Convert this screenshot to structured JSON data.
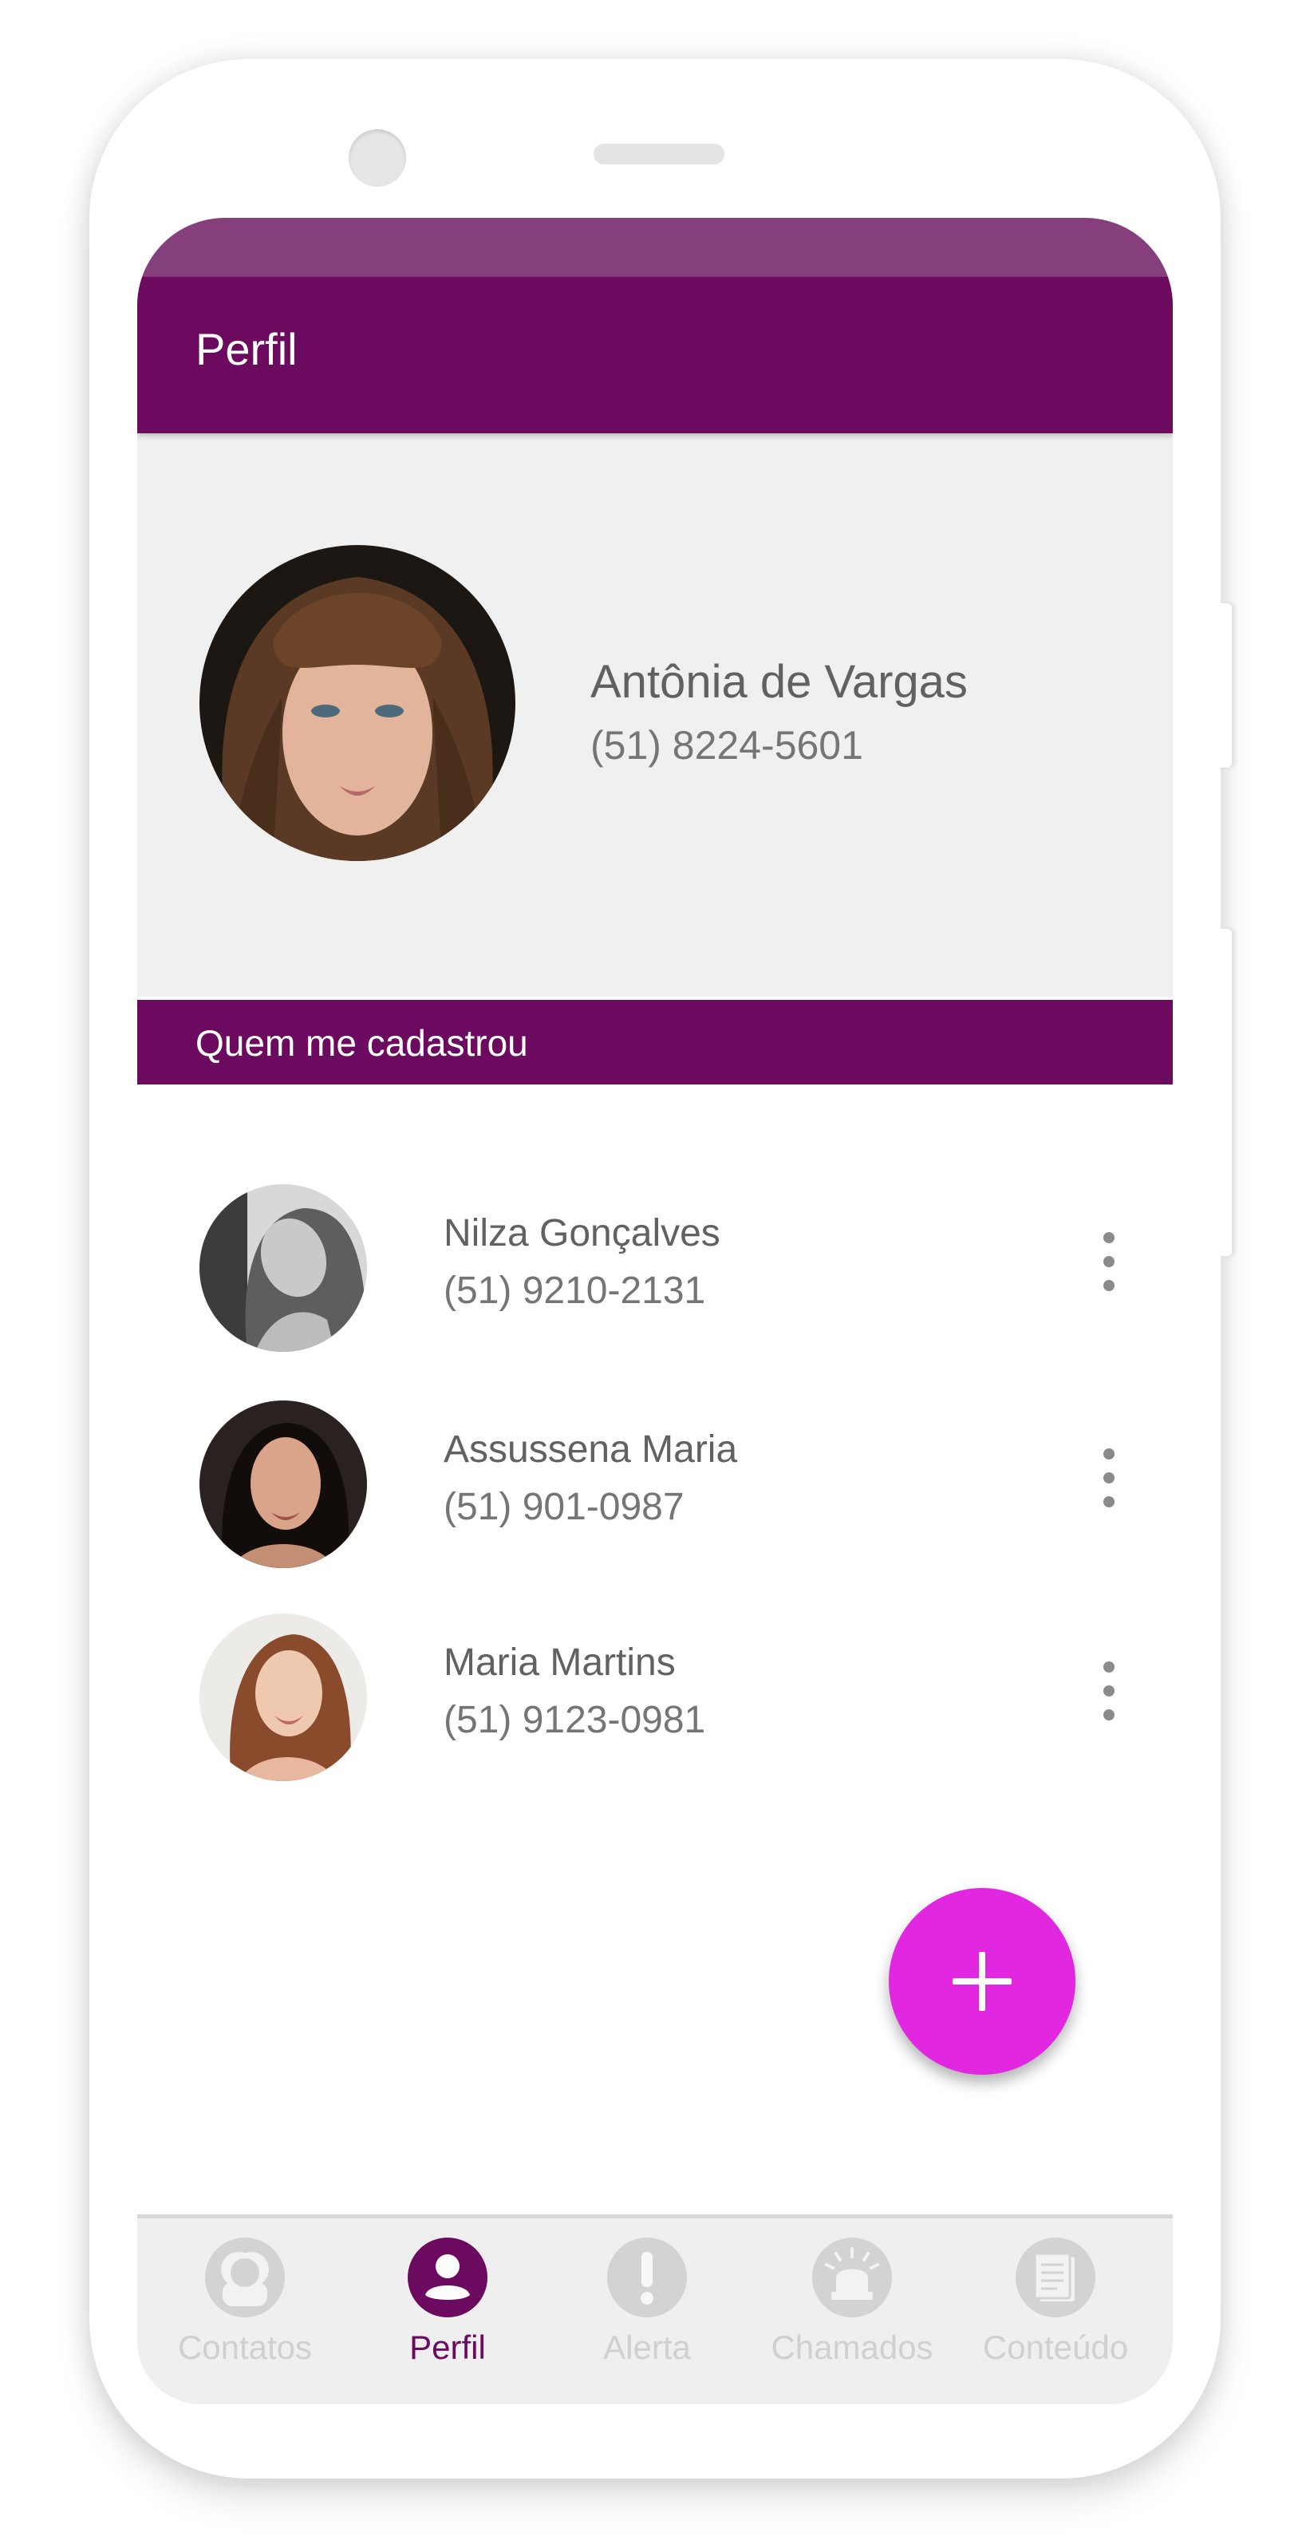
{
  "colors": {
    "primary": "#6b0a5f",
    "status_bar": "#843f7c",
    "fab": "#e128e0",
    "card_background": "#f0f0f0",
    "nav_inactive": "#d3d3d3"
  },
  "appbar": {
    "title": "Perfil"
  },
  "profile": {
    "name": "Antônia de Vargas",
    "phone": "(51) 8224-5601",
    "avatar": "profile-photo"
  },
  "section": {
    "title": "Quem me cadastrou"
  },
  "contacts": [
    {
      "name": "Nilza Gonçalves",
      "phone": "(51) 9210-2131",
      "menu_icon": "more-vert-icon"
    },
    {
      "name": "Assussena Maria",
      "phone": "(51) 901-0987",
      "menu_icon": "more-vert-icon"
    },
    {
      "name": "Maria Martins",
      "phone": "(51) 9123-0981",
      "menu_icon": "more-vert-icon"
    }
  ],
  "fab": {
    "icon": "plus-icon"
  },
  "bottom_nav": {
    "active": "Perfil",
    "items": [
      {
        "label": "Contatos",
        "icon": "contacts-icon"
      },
      {
        "label": "Perfil",
        "icon": "person-icon"
      },
      {
        "label": "Alerta",
        "icon": "alert-icon"
      },
      {
        "label": "Chamados",
        "icon": "siren-icon"
      },
      {
        "label": "Conteúdo",
        "icon": "document-icon"
      }
    ]
  }
}
